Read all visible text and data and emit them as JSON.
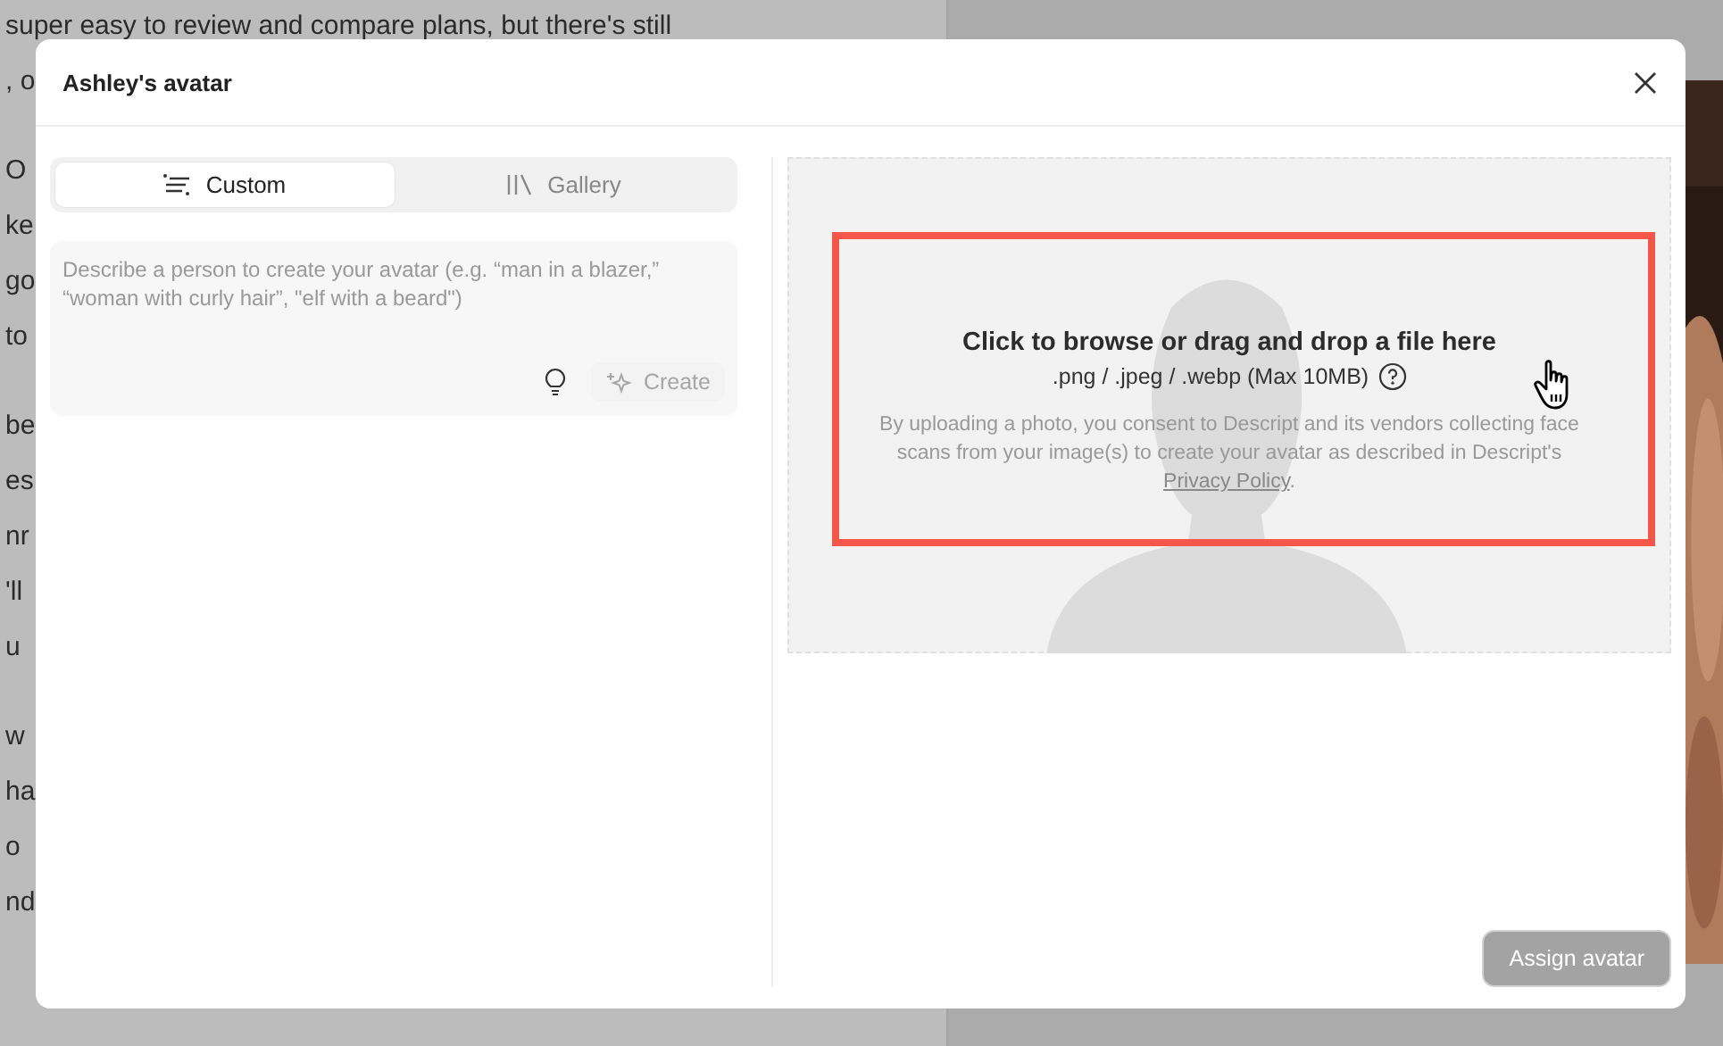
{
  "document": {
    "paragraphs": [
      [
        "super easy to review and compare plans, but there's still",
        ", o"
      ],
      [
        "O",
        "ke",
        "go",
        "to"
      ],
      [
        "be",
        "es",
        "nr",
        "'ll",
        "u"
      ],
      [
        "w",
        "ha",
        "o",
        "nd"
      ]
    ]
  },
  "dialog": {
    "title": "Ashley's avatar",
    "tabs": [
      {
        "label": "Custom",
        "selected": true
      },
      {
        "label": "Gallery",
        "selected": false
      }
    ],
    "prompt": {
      "placeholder": "Describe a person to create your avatar (e.g. “man in a blazer,” “woman with curly hair”, \"elf with a beard\")"
    },
    "create_button": {
      "label": "Create",
      "disabled": true
    },
    "upload": {
      "title": "Click to browse or drag and drop a file here",
      "formats": ".png / .jpeg / .webp (Max 10MB)",
      "consent": "By uploading a photo, you consent to Descript and its vendors collecting face scans from your image(s) to create your avatar as described in Descript's",
      "link": "Privacy Policy",
      "after": ".",
      "highlighted": true
    },
    "assign_button": {
      "label": "Assign avatar",
      "disabled": true
    }
  }
}
